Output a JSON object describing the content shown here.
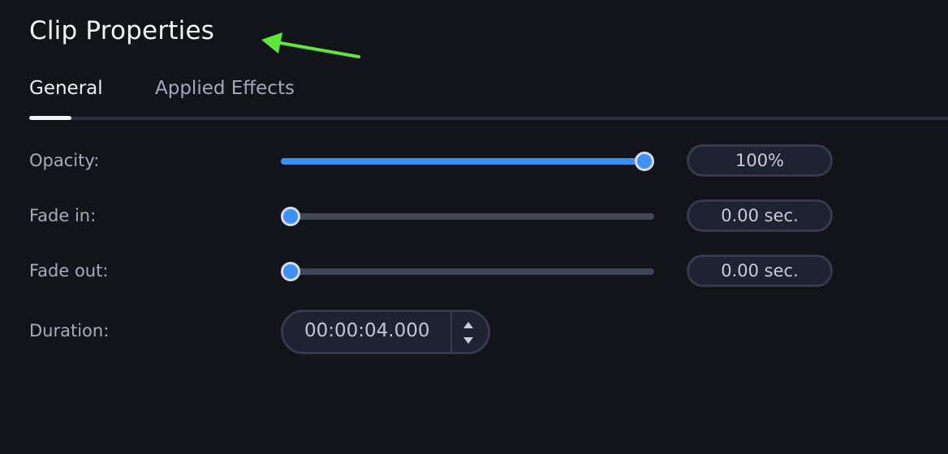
{
  "panel": {
    "title": "Clip Properties"
  },
  "annotation": {
    "arrow_color": "#5fe83c",
    "icon": "arrow-left-icon"
  },
  "tabs": [
    {
      "label": "General",
      "active": true
    },
    {
      "label": "Applied Effects",
      "active": false
    }
  ],
  "properties": {
    "opacity": {
      "label": "Opacity:",
      "value": "100%",
      "slider_fraction": 1.0
    },
    "fade_in": {
      "label": "Fade in:",
      "value": "0.00 sec.",
      "slider_fraction": 0.0
    },
    "fade_out": {
      "label": "Fade out:",
      "value": "0.00 sec.",
      "slider_fraction": 0.0
    },
    "duration": {
      "label": "Duration:",
      "value": "00:00:04.000",
      "up_icon": "triangle-up-icon",
      "down_icon": "triangle-down-icon"
    }
  },
  "colors": {
    "accent": "#3d8ef2",
    "background": "#131419",
    "track": "#414657"
  }
}
